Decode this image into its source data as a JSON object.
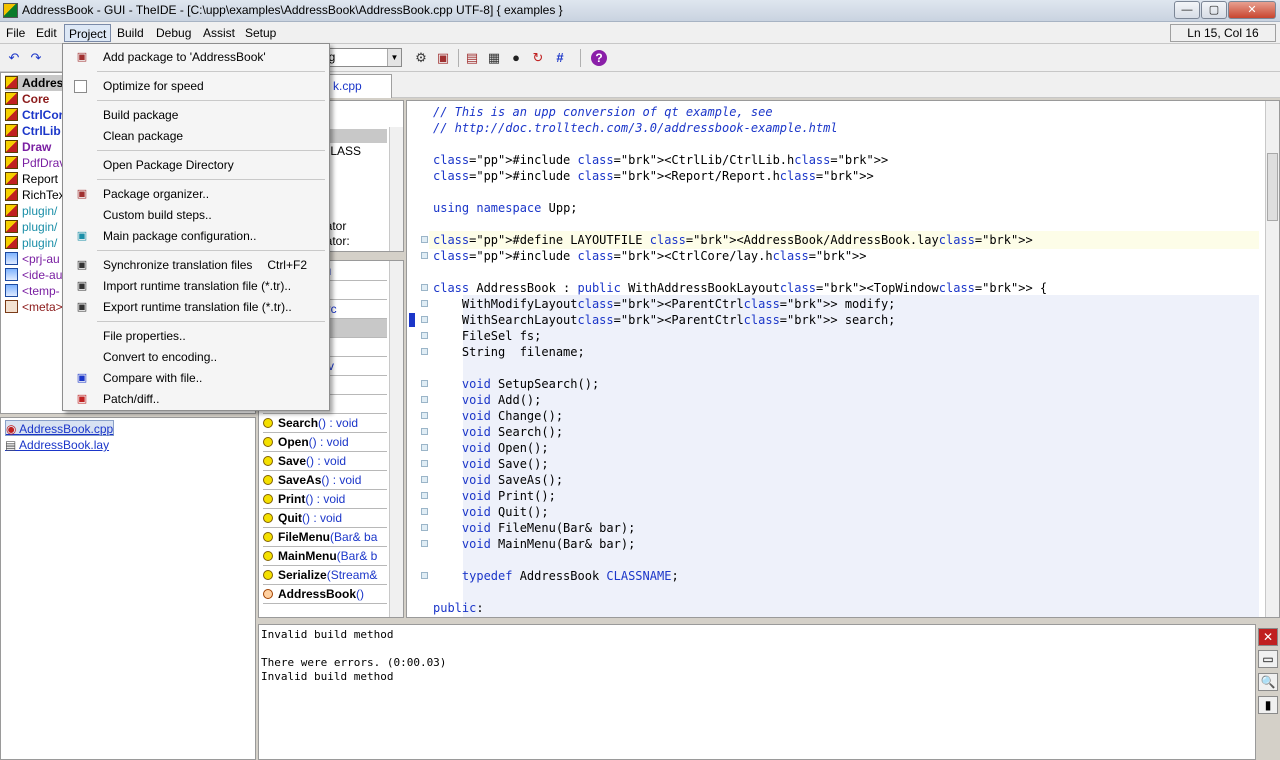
{
  "window": {
    "title": "AddressBook - GUI - TheIDE - [C:\\upp\\examples\\AddressBook\\AddressBook.cpp UTF-8] { examples }",
    "min_label": "—",
    "max_label": "▢",
    "close_label": "✕"
  },
  "menubar": {
    "items": [
      "File",
      "Edit",
      "Project",
      "Build",
      "Debug",
      "Assist",
      "Setup"
    ],
    "cursor_position": "Ln 15, Col 16"
  },
  "toolbar": {
    "build_config_value": "ug"
  },
  "tab": {
    "label": "k.cpp"
  },
  "packages": {
    "items": [
      {
        "label": "Addres",
        "color": "#000000",
        "bold": true,
        "icon": "package-icon"
      },
      {
        "label": "Core",
        "color": "#8b1a1a",
        "bold": true,
        "icon": "package-icon"
      },
      {
        "label": "CtrlCor",
        "color": "#1b36c9",
        "bold": true,
        "icon": "package-icon"
      },
      {
        "label": "CtrlLib",
        "color": "#1b36c9",
        "bold": true,
        "icon": "package-icon"
      },
      {
        "label": "Draw",
        "color": "#7a1fa2",
        "bold": true,
        "icon": "package-icon"
      },
      {
        "label": "PdfDrav",
        "color": "#7a1fa2",
        "bold": false,
        "icon": "package-icon"
      },
      {
        "label": "Report",
        "color": "#000000",
        "bold": false,
        "icon": "package-icon"
      },
      {
        "label": "RichTex",
        "color": "#000000",
        "bold": false,
        "icon": "package-icon"
      },
      {
        "label": "plugin/",
        "color": "#1b8fa8",
        "bold": false,
        "icon": "package-icon"
      },
      {
        "label": "plugin/",
        "color": "#1b8fa8",
        "bold": false,
        "icon": "package-icon"
      },
      {
        "label": "plugin/",
        "color": "#1b8fa8",
        "bold": false,
        "icon": "package-icon"
      },
      {
        "label": "<prj-au",
        "color": "#7a1fa2",
        "bold": false,
        "icon": "nest-icon"
      },
      {
        "label": "<ide-au",
        "color": "#7a1fa2",
        "bold": false,
        "icon": "nest-icon"
      },
      {
        "label": "<temp-",
        "color": "#7a1fa2",
        "bold": false,
        "icon": "nest-icon"
      },
      {
        "label": "<meta>",
        "color": "#8b1a1a",
        "bold": false,
        "icon": "meta-icon"
      }
    ]
  },
  "files": {
    "items": [
      "AddressBook.cpp",
      "AddressBook.lay"
    ]
  },
  "navigator": {
    "top_items": [
      "k",
      "k::CLASS",
      "",
      "ta",
      "",
      "",
      "lterator",
      "lterator:"
    ],
    "members": [
      {
        "name": "Book",
        "sig": " : pu"
      },
      {
        "name": "",
        "sig": " WithMoc"
      },
      {
        "name": "",
        "sig": " WithSearc"
      },
      {
        "name": "el",
        "sig": ""
      },
      {
        "name": "",
        "sig": "e : String"
      },
      {
        "name": "earch",
        "sig": "() : v"
      },
      {
        "name": "",
        "sig": "void"
      },
      {
        "name": "",
        "sig": "() : void"
      },
      {
        "name": "Search",
        "sig": "() : void"
      },
      {
        "name": "Open",
        "sig": "() : void"
      },
      {
        "name": "Save",
        "sig": "() : void"
      },
      {
        "name": "SaveAs",
        "sig": "() : void"
      },
      {
        "name": "Print",
        "sig": "() : void"
      },
      {
        "name": "Quit",
        "sig": "() : void"
      },
      {
        "name": "FileMenu",
        "sig": "(Bar& ba"
      },
      {
        "name": "MainMenu",
        "sig": "(Bar& b"
      },
      {
        "name": "Serialize",
        "sig": "(Stream&"
      },
      {
        "name": "AddressBook",
        "sig": "()"
      }
    ]
  },
  "editor": {
    "lines": [
      "// This is an upp conversion of qt example, see",
      "// http://doc.trolltech.com/3.0/addressbook-example.html",
      "",
      "#include <CtrlLib/CtrlLib.h>",
      "#include <Report/Report.h>",
      "",
      "using namespace Upp;",
      "",
      "#define LAYOUTFILE <AddressBook/AddressBook.lay>",
      "#include <CtrlCore/lay.h>",
      "",
      "class AddressBook : public WithAddressBookLayout<TopWindow> {",
      "    WithModifyLayout<ParentCtrl> modify;",
      "    WithSearchLayout<ParentCtrl> search;",
      "    FileSel fs;",
      "    String  filename;",
      "",
      "    void SetupSearch();",
      "    void Add();",
      "    void Change();",
      "    void Search();",
      "    void Open();",
      "    void Save();",
      "    void SaveAs();",
      "    void Print();",
      "    void Quit();",
      "    void FileMenu(Bar& bar);",
      "    void MainMenu(Bar& bar);",
      "",
      "    typedef AddressBook CLASSNAME;",
      "",
      "public:"
    ]
  },
  "console": {
    "lines": [
      "Invalid build method",
      "",
      "There were errors. (0:00.03)",
      "Invalid build method"
    ]
  },
  "project_menu": {
    "items": [
      {
        "label": "Add package to 'AddressBook'",
        "icon": "add-package-icon",
        "shortcut": ""
      },
      {
        "label": "Optimize for speed",
        "icon": "checkbox",
        "shortcut": ""
      },
      {
        "label": "Build package",
        "icon": "",
        "shortcut": ""
      },
      {
        "label": "Clean package",
        "icon": "",
        "shortcut": ""
      },
      {
        "label": "Open Package Directory",
        "icon": "",
        "shortcut": ""
      },
      {
        "label": "Package organizer..",
        "icon": "package-organizer-icon",
        "shortcut": ""
      },
      {
        "label": "Custom build steps..",
        "icon": "",
        "shortcut": ""
      },
      {
        "label": "Main package configuration..",
        "icon": "main-package-icon",
        "shortcut": ""
      },
      {
        "label": "Synchronize translation files",
        "icon": "sync-translation-icon",
        "shortcut": "Ctrl+F2"
      },
      {
        "label": "Import runtime translation file (*.tr)..",
        "icon": "import-translation-icon",
        "shortcut": ""
      },
      {
        "label": "Export runtime translation file (*.tr)..",
        "icon": "export-translation-icon",
        "shortcut": ""
      },
      {
        "label": "File properties..",
        "icon": "",
        "shortcut": ""
      },
      {
        "label": "Convert to encoding..",
        "icon": "",
        "shortcut": ""
      },
      {
        "label": "Compare with file..",
        "icon": "compare-icon",
        "shortcut": ""
      },
      {
        "label": "Patch/diff..",
        "icon": "patch-icon",
        "shortcut": ""
      }
    ]
  }
}
